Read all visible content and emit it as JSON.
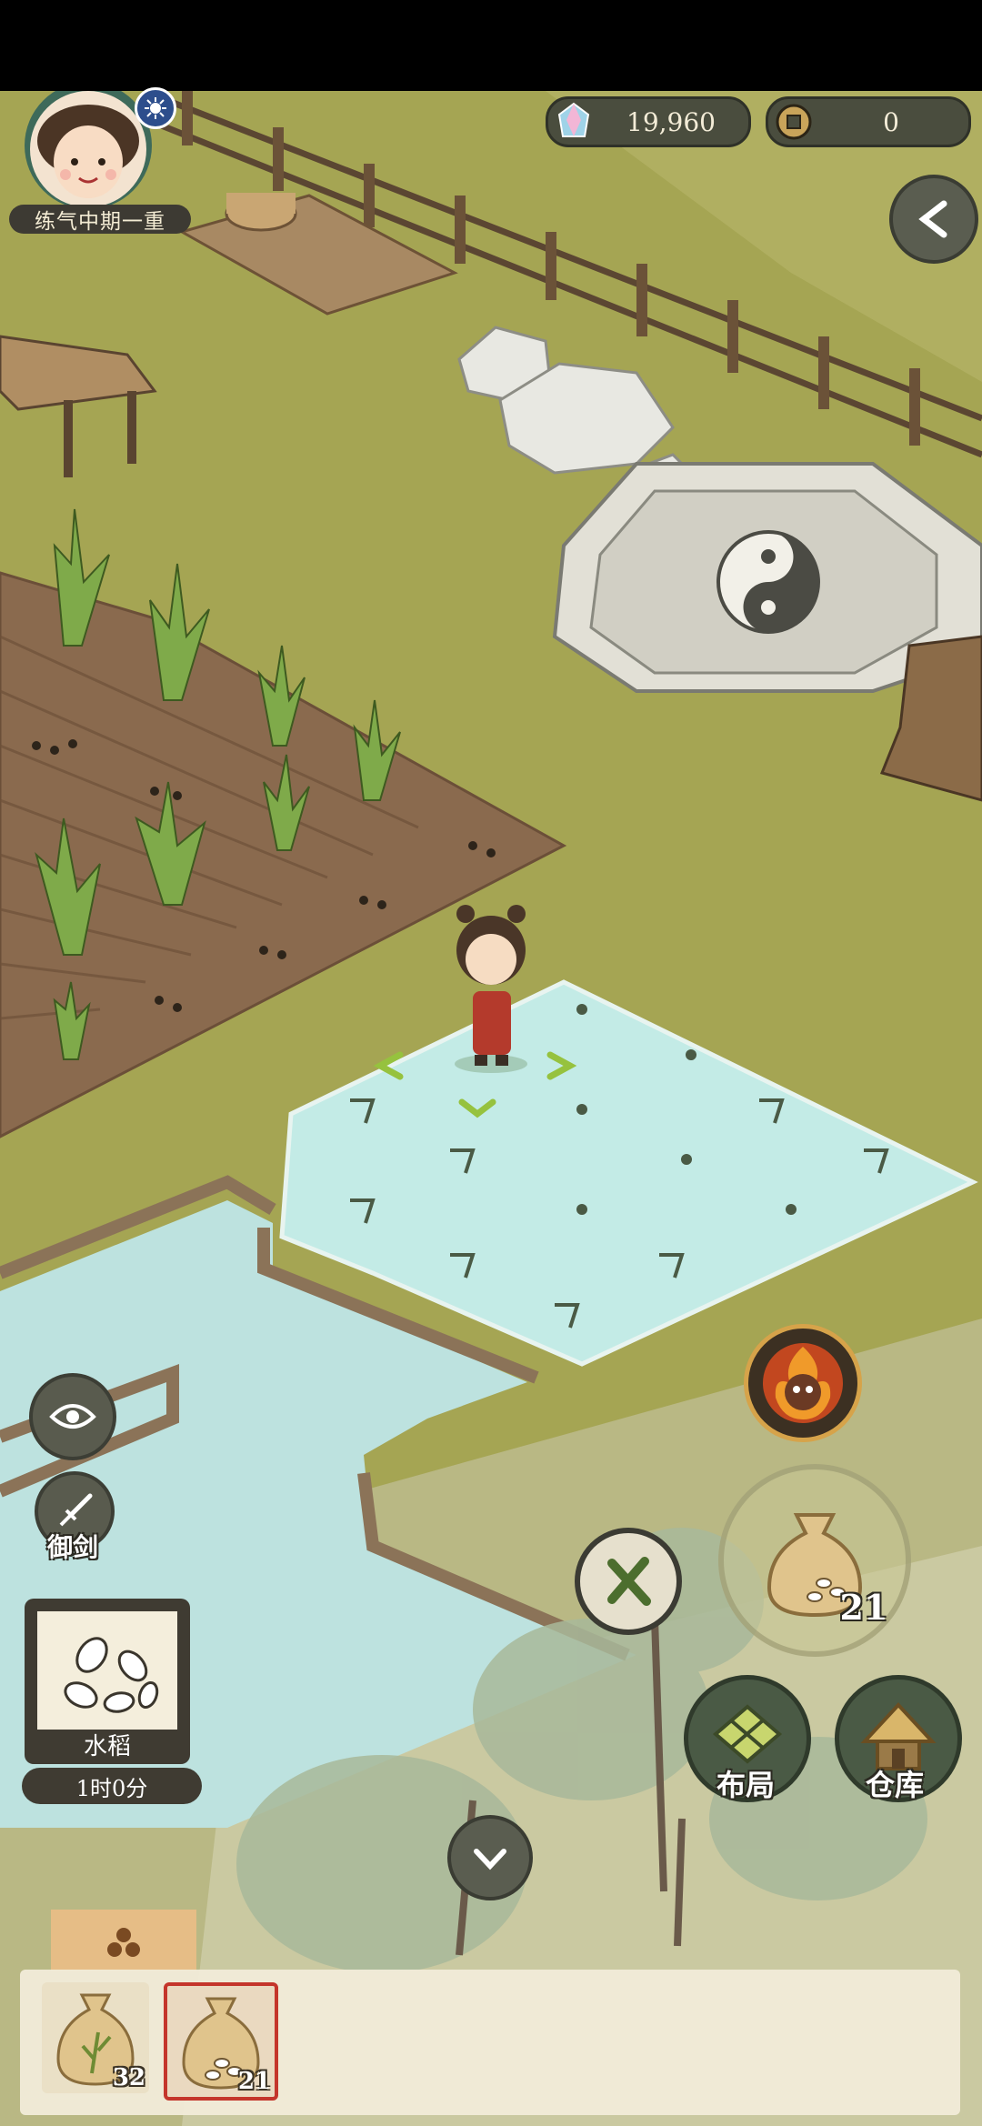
{
  "hud": {
    "spirit_stones": "19,960",
    "coins": "0",
    "rank": "练气中期一重"
  },
  "side_buttons": {
    "sword_label": "御剑"
  },
  "crop": {
    "name": "水稻",
    "time": "1时0分"
  },
  "seed_bag_main": {
    "count": "21"
  },
  "actions": {
    "layout_label": "布局",
    "warehouse_label": "仓库"
  },
  "seed_slots": [
    {
      "name": "grass-seed-bag",
      "count": "32"
    },
    {
      "name": "rice-seed-bag",
      "count": "21",
      "selected": true
    }
  ],
  "colors": {
    "grass": "#a5a553",
    "soil": "#8a6a4e",
    "water": "#c3ebe6",
    "accent_red": "#c4352b",
    "hud_dark": "#3d3a33"
  },
  "icons": {
    "back": "chevron-left-icon",
    "eye": "eye-icon",
    "sword": "sword-icon",
    "cancel": "cross-icon",
    "collapse": "chevron-down-icon",
    "stone": "crystal-icon",
    "coin": "coin-icon"
  }
}
